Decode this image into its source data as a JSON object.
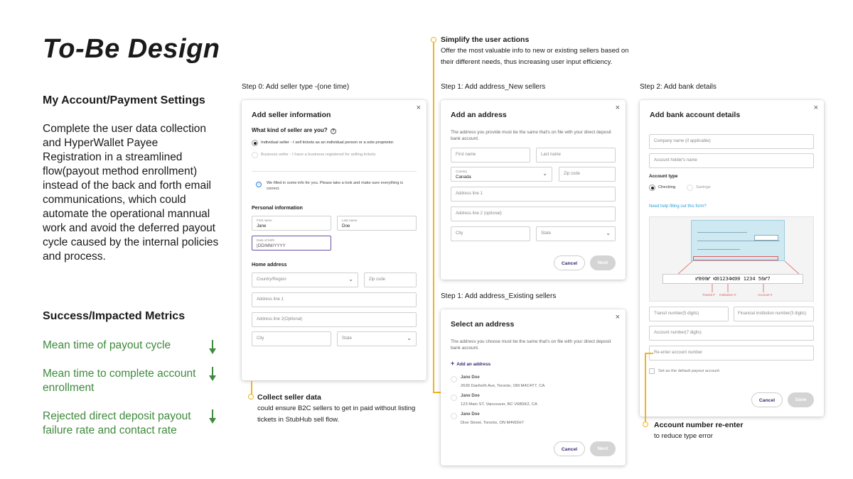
{
  "title": "To-Be Design",
  "settings": {
    "heading": "My Account/Payment Settings",
    "description": "Complete the user data collection and HyperWallet Payee Registration in a streamlined flow(payout method enrollment) instead of  the back and forth email communications, which could automate the operational mannual work and avoid the deferred payout cycle caused by the internal policies and process."
  },
  "metrics": {
    "heading": "Success/Impacted Metrics",
    "items": [
      "Mean time of payout cycle",
      "Mean time to complete account enrollment",
      "Rejected direct deposit payout failure rate and contact rate"
    ],
    "accent": "#3f8a3d"
  },
  "annotations": {
    "simplify": {
      "title": "Simplify the user actions",
      "text": "Offer the most valuable info to new or existing sellers based on their different needs, thus increasing user input efficiency."
    },
    "collect": {
      "title": "Collect seller data",
      "text": "could ensure B2C sellers to get in paid without listing tickets in StubHub sell flow."
    },
    "reenter": {
      "title": "Account number re-enter",
      "text": "to reduce type error"
    },
    "color": "#f0b41c"
  },
  "steps": {
    "step0": "Step 0: Add seller type -(one time)",
    "step1_new": "Step 1: Add address_New sellers",
    "step1_existing": "Step 1: Add address_Existing sellers",
    "step2": "Step 2: Add bank details"
  },
  "seller_modal": {
    "close": "×",
    "title": "Add seller information",
    "question": "What kind of seller are you?",
    "info_icon": "?",
    "option_individual": "Individual seller - I sell tickets as an individual person or a sole proprietor.",
    "option_business": "Business seller - I have a business registered for selling tickets.",
    "notice_icon": "i",
    "notice": "We filled in some info for you. Please take a look and make sure everything is correct.",
    "personal_heading": "Personal information",
    "first_name_label": "First name",
    "first_name_value": "Jane",
    "last_name_label": "Last name",
    "last_name_value": "Doe",
    "dob_label": "Date of birth",
    "dob_value": "|DD/MM/YYYY",
    "home_heading": "Home address",
    "country_placeholder": "Country/Region",
    "zip_placeholder": "Zip code",
    "address1_placeholder": "Address line 1",
    "address2_placeholder": "Address line 2(Optional)",
    "city_placeholder": "City",
    "state_placeholder": "State"
  },
  "new_address_modal": {
    "close": "×",
    "title": "Add an address",
    "subtitle": "The address you provide must be the same that's on file with your direct deposit bank account.",
    "first_name": "First name",
    "last_name": "Last name",
    "country_label": "Country",
    "country_value": "Canada",
    "zip": "Zip code",
    "address1": "Address line 1",
    "address2": "Address line 2 (optional)",
    "city": "City",
    "state": "State",
    "cancel": "Cancel",
    "next": "Next"
  },
  "existing_address_modal": {
    "close": "×",
    "title": "Select an address",
    "subtitle": "The address you choose must be the same that's on file with your direct deposit bank account.",
    "add_icon": "+",
    "add_label": "Add an address",
    "addresses": [
      {
        "name": "Jane Doe",
        "line": "2639 Danforth Ave, Toronto, OM M4C4Y7, CA"
      },
      {
        "name": "Jane Doe",
        "line": "123 Main ST, Vancouver, BC V6B5K2, CA"
      },
      {
        "name": "Jane Doe",
        "line": "Dive Street, Toronto, ON M4W2H7"
      }
    ],
    "cancel": "Cancel",
    "next": "Next"
  },
  "bank_modal": {
    "close": "×",
    "title": "Add bank account details",
    "company": "Company name (if applicable)",
    "holder": "Account holder's name",
    "account_type_heading": "Account type",
    "checking": "Checking",
    "savings": "Savings",
    "help_link": "Need help filling out this form?",
    "cheque_micr": "⑈000⑈   ⑆01234⑆00   1234 56⑈7",
    "cheque_labels": [
      "Transit #",
      "Institution #",
      "Account #"
    ],
    "transit": "Transit number(5 digits)",
    "institution": "Financial institution number(3 digits)",
    "account": "Account number(7 digits)",
    "reenter": "Re-enter account number",
    "default_label": "Set as the default payout account",
    "cancel": "Cancel",
    "save": "Save"
  }
}
